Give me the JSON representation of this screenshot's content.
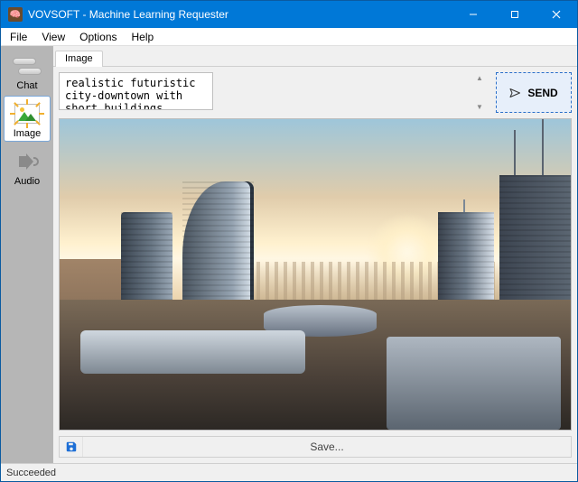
{
  "window": {
    "title": "VOVSOFT - Machine Learning Requester"
  },
  "menu": {
    "file": "File",
    "view": "View",
    "options": "Options",
    "help": "Help"
  },
  "sidebar": {
    "chat": "Chat",
    "image": "Image",
    "audio": "Audio"
  },
  "tab": {
    "label": "Image"
  },
  "prompt": {
    "text": "realistic futuristic city-downtown with short buildings, sunset"
  },
  "send": {
    "label": "SEND"
  },
  "save": {
    "label": "Save..."
  },
  "status": {
    "text": "Succeeded"
  }
}
